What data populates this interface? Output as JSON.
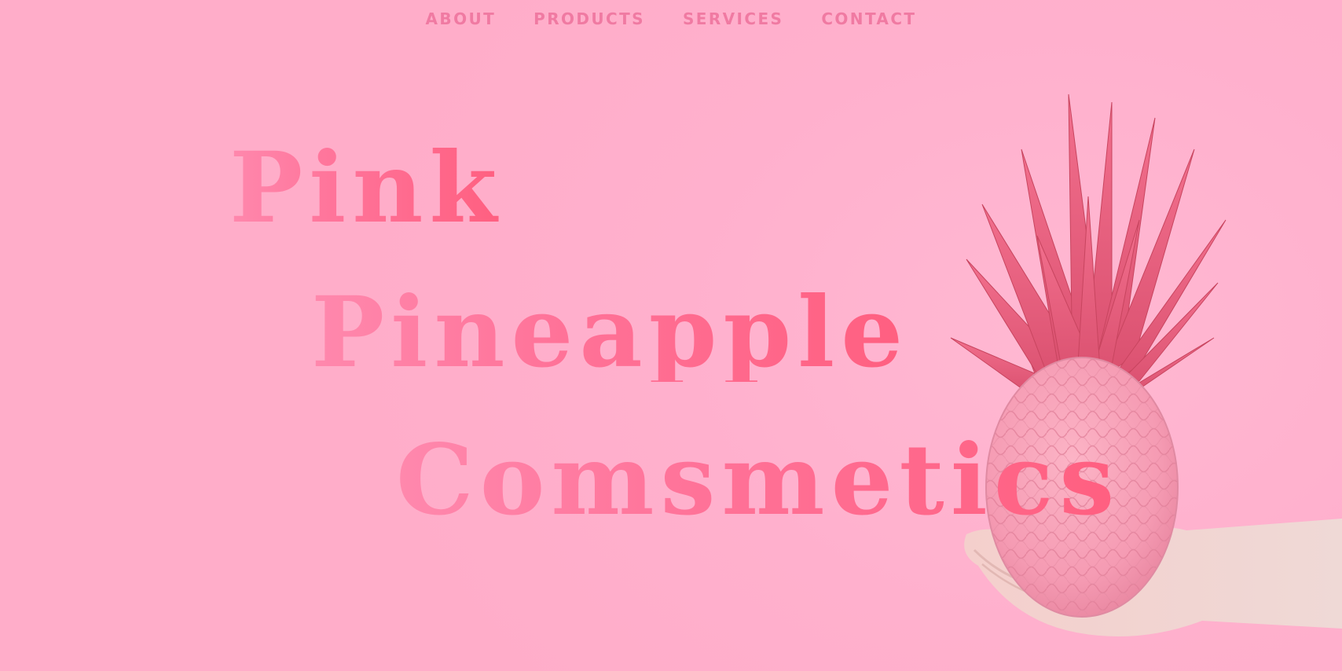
{
  "nav": {
    "items": [
      {
        "label": "ABOUT"
      },
      {
        "label": "PRODUCTS"
      },
      {
        "label": "SERVICES"
      },
      {
        "label": "CONTACT"
      }
    ]
  },
  "hero": {
    "headline_line1": "Pink",
    "headline_line2": "Pineapple",
    "headline_line3": "Comsmetics",
    "image_subject": "pink-pineapple-in-hand"
  },
  "colors": {
    "background": "#ffb2cf",
    "nav_text": "#f07aa2",
    "headline_start": "#ff88ad",
    "headline_end": "#ff5f80",
    "pineapple_leaves": "#f0607e",
    "pineapple_body": "#f9a0b8",
    "hand": "#f6d6d2"
  }
}
